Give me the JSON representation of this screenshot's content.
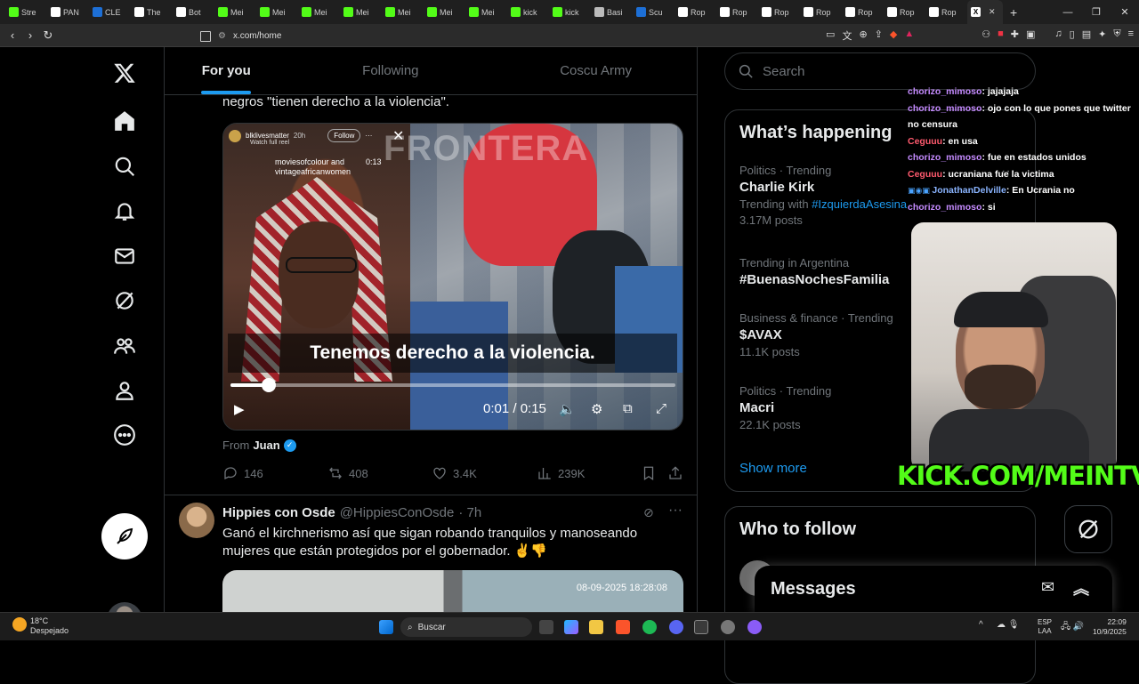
{
  "browser": {
    "tabs": [
      {
        "icon": "kick-icon",
        "label": "Stre",
        "color": "#53fc18"
      },
      {
        "icon": "pan-icon",
        "label": "PAN",
        "color": "#ffffff"
      },
      {
        "icon": "s-icon",
        "label": "CLE",
        "color": "#1d6fd6"
      },
      {
        "icon": "diamond-icon",
        "label": "The",
        "color": "#ffffff"
      },
      {
        "icon": "diamond-icon",
        "label": "Bot",
        "color": "#ffffff"
      },
      {
        "icon": "kick-icon",
        "label": "Mei",
        "color": "#53fc18"
      },
      {
        "icon": "kick-icon",
        "label": "Mei",
        "color": "#53fc18"
      },
      {
        "icon": "kick-icon",
        "label": "Mei",
        "color": "#53fc18"
      },
      {
        "icon": "kick-icon",
        "label": "Mei",
        "color": "#53fc18"
      },
      {
        "icon": "kick-icon",
        "label": "Mei",
        "color": "#53fc18"
      },
      {
        "icon": "kick-icon",
        "label": "Mei",
        "color": "#53fc18"
      },
      {
        "icon": "kick-icon",
        "label": "Mei",
        "color": "#53fc18"
      },
      {
        "icon": "kick-icon",
        "label": "kick",
        "color": "#53fc18"
      },
      {
        "icon": "kick-icon",
        "label": "kick",
        "color": "#53fc18"
      },
      {
        "icon": "globe-icon",
        "label": "Basi",
        "color": "#bbbbbb"
      },
      {
        "icon": "s-icon",
        "label": "Scu",
        "color": "#1d6fd6"
      },
      {
        "icon": "s-icon",
        "label": "Rop",
        "color": "#ffffff"
      },
      {
        "icon": "s-icon",
        "label": "Rop",
        "color": "#ffffff"
      },
      {
        "icon": "s-icon",
        "label": "Rop",
        "color": "#ffffff"
      },
      {
        "icon": "s-icon",
        "label": "Rop",
        "color": "#ffffff"
      },
      {
        "icon": "s-icon",
        "label": "Rop",
        "color": "#ffffff"
      },
      {
        "icon": "s-icon",
        "label": "Rop",
        "color": "#ffffff"
      },
      {
        "icon": "s-icon",
        "label": "Rop",
        "color": "#ffffff"
      }
    ],
    "active_tab_icon": "x-logo-icon",
    "url": "x.com/home"
  },
  "feed": {
    "tabs": [
      "For you",
      "Following",
      "Coscu Army"
    ],
    "active_tab": "For you",
    "tweet1": {
      "text_tail": "negros \"tienen derecho a la violencia\".",
      "video": {
        "overlay_user": "blklivesmatter",
        "overlay_time": "20h",
        "overlay_follow": "Follow",
        "overlay_watch": "Watch full reel",
        "overlay_caption_small": "moviesofcolour and vintageafricanwomen",
        "overlay_ts": "0:13",
        "watermark": "FRONTERA",
        "caption": "Tenemos derecho a la violencia.",
        "time": "0:01 / 0:15",
        "progress": 0.085
      },
      "from_label": "From",
      "from_user": "Juan",
      "replies": "146",
      "reposts": "408",
      "likes": "3.4K",
      "views": "239K"
    },
    "tweet2": {
      "name": "Hippies con Osde",
      "handle": "@HippiesConOsde",
      "time": "· 7h",
      "text": "Ganó el kirchnerismo así que sigan robando tranquilos y manoseando mujeres que están protegidos por el gobernador. ✌️👎",
      "media_timestamp": "08-09-2025 18:28:08"
    }
  },
  "sidebar": {
    "search_placeholder": "Search",
    "happening_title": "What’s happening",
    "trends": [
      {
        "meta": "Politics · Trending",
        "name": "Charlie Kirk",
        "extra_prefix": "Trending with",
        "extra_link": "#IzquierdaAsesina",
        "count": "3.17M posts"
      },
      {
        "meta": "Trending in Argentina",
        "name": "#BuenasNochesFamilia",
        "count": ""
      },
      {
        "meta": "Business & finance · Trending",
        "name": "$AVAX",
        "count": "11.1K posts"
      },
      {
        "meta": "Politics · Trending",
        "name": "Macri",
        "count": "22.1K posts"
      }
    ],
    "show_more": "Show more",
    "who_to_follow": "Who to follow",
    "messages": "Messages"
  },
  "stream": {
    "chat": [
      {
        "user": "chorizo_mimoso",
        "color": "#c58bff",
        "msg": ": jajajaja"
      },
      {
        "user": "chorizo_mimoso",
        "color": "#c58bff",
        "msg": ": ojo con lo que pones que twitter no censura"
      },
      {
        "user": "Ceguuu",
        "color": "#ff5a6e",
        "msg": ": en usa"
      },
      {
        "user": "chorizo_mimoso",
        "color": "#c58bff",
        "msg": ": fue en estados unidos"
      },
      {
        "user": "Ceguuu",
        "color": "#ff5a6e",
        "msg": ": ucraniana fue la victima"
      },
      {
        "user": "JonathanDelville",
        "color": "#8ab4ff",
        "msg": ": En Ucrania no"
      },
      {
        "user": "chorizo_mimoso",
        "color": "#c58bff",
        "msg": ": si"
      }
    ],
    "kick_banner": "KICK.COM/MEINTV"
  },
  "taskbar": {
    "weather_temp": "18°C",
    "weather_desc": "Despejado",
    "search_label": "Buscar",
    "lang": "ESP",
    "lang2": "LAA",
    "time": "22:09",
    "date": "10/9/2025"
  }
}
